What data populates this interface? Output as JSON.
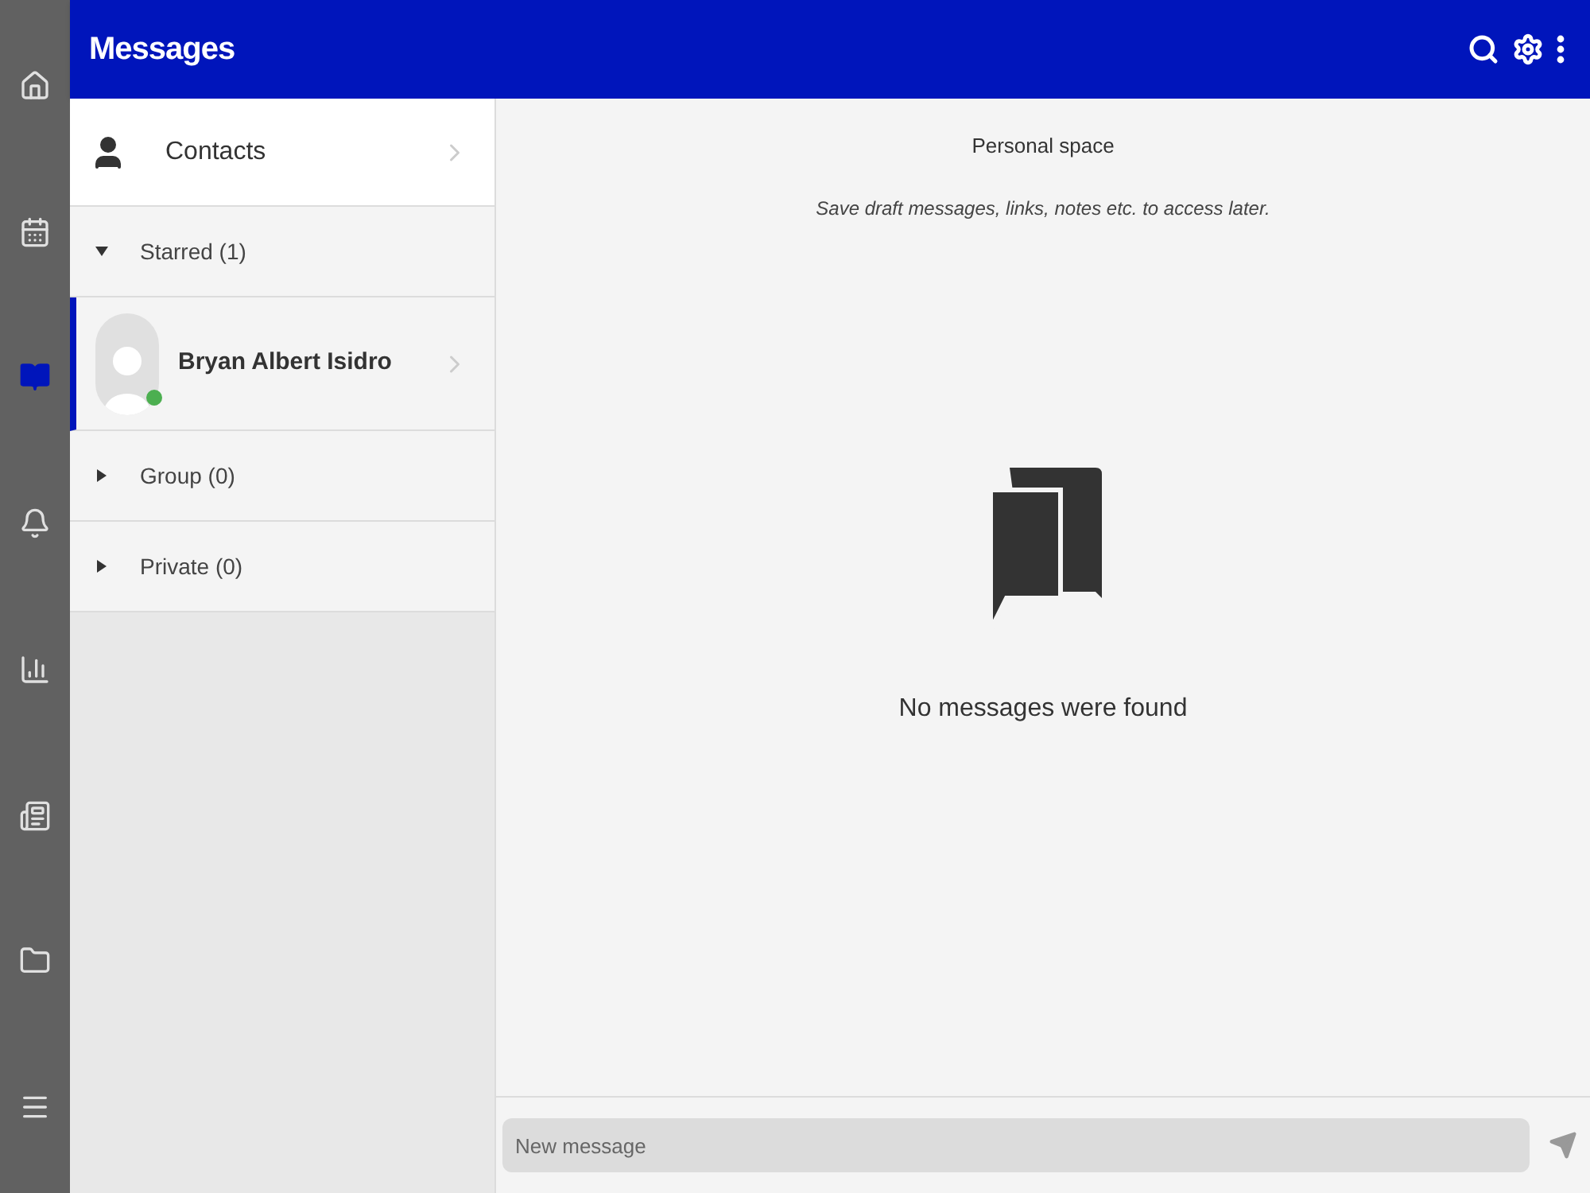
{
  "nav": [
    {
      "selected": false
    },
    {
      "selected": false
    },
    {
      "selected": true
    },
    {
      "selected": false
    },
    {
      "selected": false
    },
    {
      "selected": false
    },
    {
      "selected": false
    },
    {
      "selected": false
    }
  ],
  "header": {
    "title": "Messages"
  },
  "contacts_link": {
    "label": "Contacts"
  },
  "groups": [
    {
      "label": "Starred (1)",
      "expanded": true,
      "contacts": [
        {
          "name": "Bryan Albert Isidro",
          "online": true,
          "selected": true
        }
      ]
    },
    {
      "label": "Group (0)",
      "expanded": false
    },
    {
      "label": "Private (0)",
      "expanded": false
    }
  ],
  "chat": {
    "title": "Personal space",
    "subtitle": "Save draft messages, links, notes etc. to access later.",
    "empty_text": "No messages were found"
  },
  "composer": {
    "placeholder": "New message"
  }
}
